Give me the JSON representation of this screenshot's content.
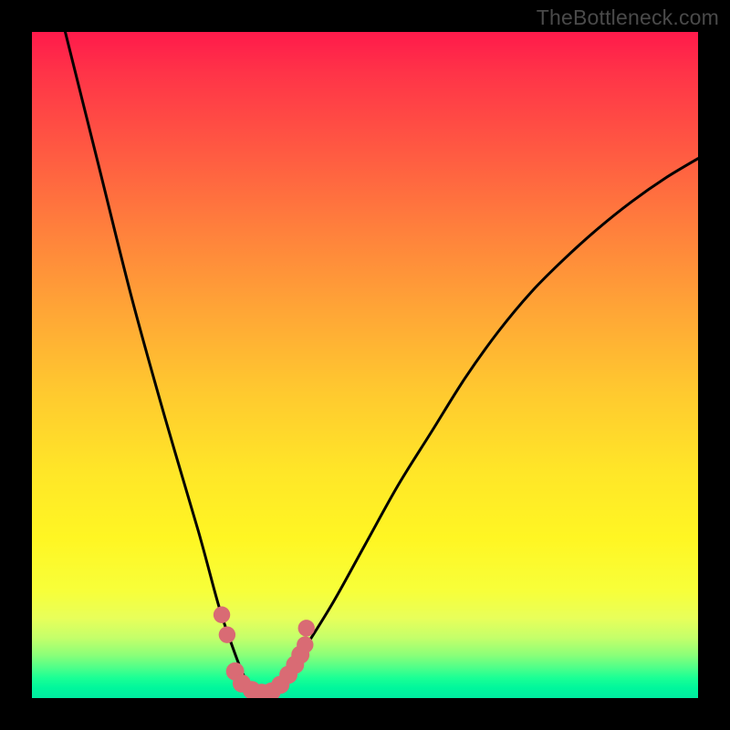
{
  "watermark": "TheBottleneck.com",
  "chart_data": {
    "type": "line",
    "title": "",
    "xlabel": "",
    "ylabel": "",
    "xlim": [
      0,
      100
    ],
    "ylim": [
      0,
      100
    ],
    "series": [
      {
        "name": "bottleneck-curve",
        "x": [
          5,
          10,
          15,
          20,
          25,
          28,
          30,
          32,
          34,
          35,
          36,
          38,
          40,
          45,
          50,
          55,
          60,
          65,
          70,
          75,
          80,
          85,
          90,
          95,
          100
        ],
        "values": [
          100,
          80,
          60,
          42,
          25,
          14,
          8,
          3,
          1,
          0.5,
          1,
          3,
          6,
          14,
          23,
          32,
          40,
          48,
          55,
          61,
          66,
          70.5,
          74.5,
          78,
          81
        ]
      }
    ],
    "markers": {
      "name": "highlight-points",
      "color": "#d96b74",
      "points": [
        {
          "x": 28.5,
          "y": 12.5,
          "r": 1.2
        },
        {
          "x": 29.3,
          "y": 9.5,
          "r": 1.2
        },
        {
          "x": 30.5,
          "y": 4.0,
          "r": 1.3
        },
        {
          "x": 31.5,
          "y": 2.2,
          "r": 1.3
        },
        {
          "x": 33.0,
          "y": 1.2,
          "r": 1.3
        },
        {
          "x": 34.5,
          "y": 0.8,
          "r": 1.3
        },
        {
          "x": 36.0,
          "y": 1.0,
          "r": 1.3
        },
        {
          "x": 37.3,
          "y": 2.0,
          "r": 1.3
        },
        {
          "x": 38.5,
          "y": 3.5,
          "r": 1.3
        },
        {
          "x": 39.5,
          "y": 5.0,
          "r": 1.3
        },
        {
          "x": 40.3,
          "y": 6.5,
          "r": 1.3
        },
        {
          "x": 41.0,
          "y": 8.0,
          "r": 1.2
        },
        {
          "x": 41.2,
          "y": 10.5,
          "r": 1.2
        }
      ]
    }
  }
}
